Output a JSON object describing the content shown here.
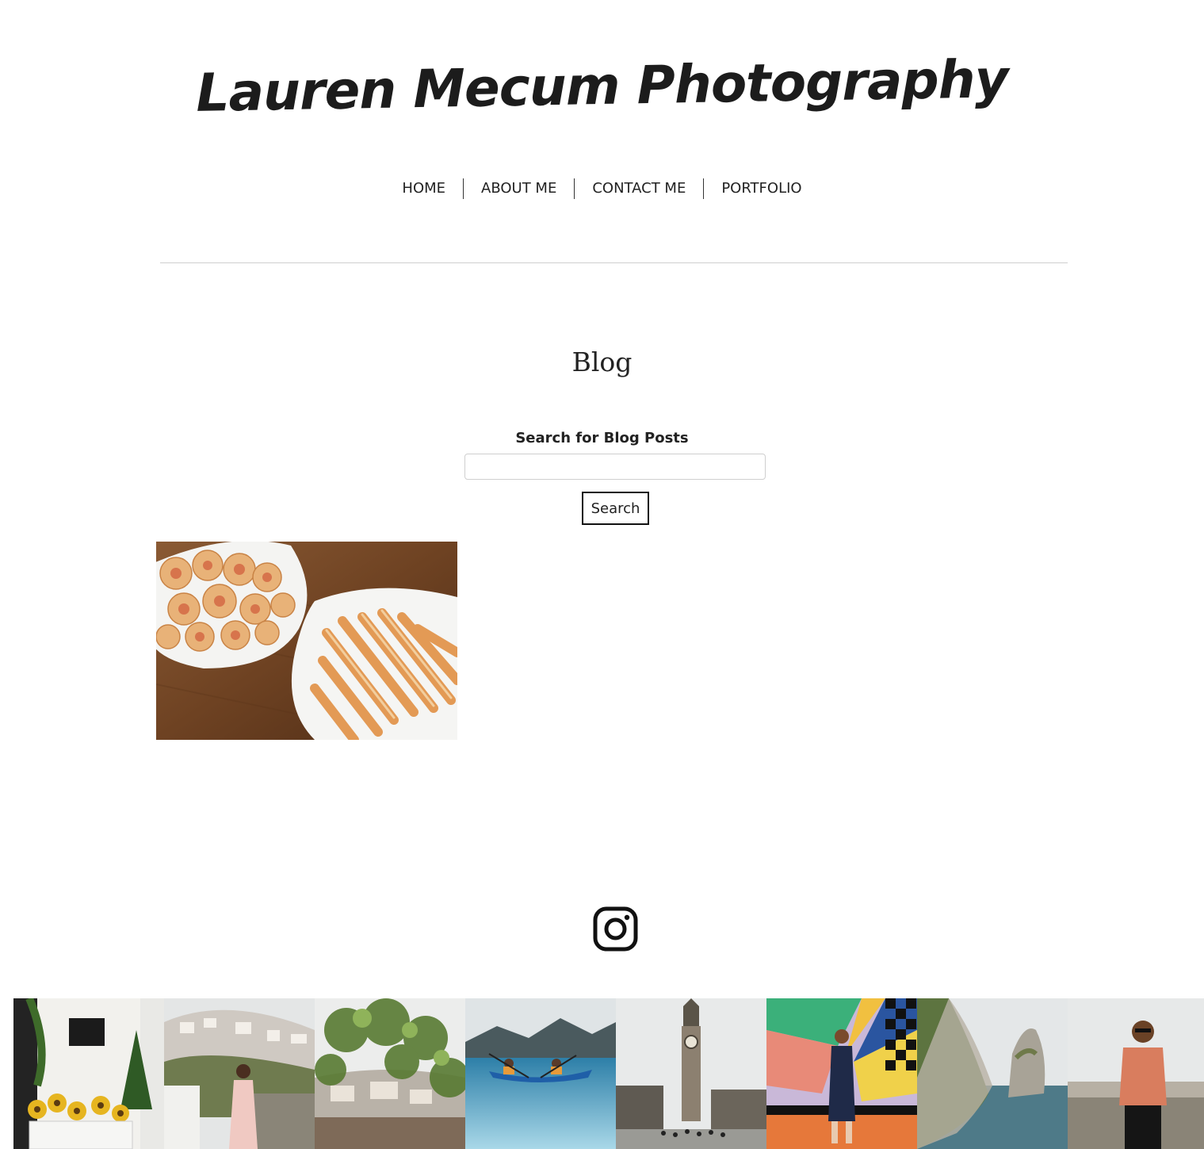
{
  "site": {
    "title": "Lauren Mecum Photography"
  },
  "nav": {
    "items": [
      {
        "label": "HOME"
      },
      {
        "label": "ABOUT ME"
      },
      {
        "label": "CONTACT ME"
      },
      {
        "label": "PORTFOLIO"
      }
    ]
  },
  "page": {
    "title": "Blog"
  },
  "search": {
    "label": "Search for Blog Posts",
    "value": "",
    "placeholder": "",
    "button_label": "Search"
  },
  "social": {
    "icon": "instagram-icon"
  },
  "colors": {
    "text": "#222222",
    "divider": "#cfcfcf",
    "button_border": "#111111"
  }
}
